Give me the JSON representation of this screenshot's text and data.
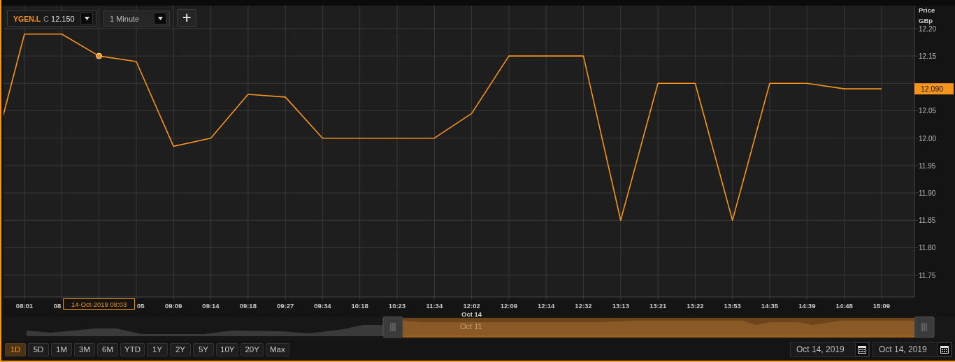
{
  "instrument": {
    "symbol": "YGEN.L",
    "price_label": "C",
    "price": "12.150"
  },
  "interval": {
    "value": "1 Minute"
  },
  "add_button": {
    "label": "+"
  },
  "chart": {
    "axis_title": "Price",
    "axis_unit": "GBp",
    "tooltip": "14-Oct-2019 08:03",
    "date_label": "Oct 14",
    "last_price": "12.090",
    "chart_data": {
      "type": "line",
      "grid": true,
      "categories": [
        null,
        "08:01",
        "08",
        null,
        "05",
        "09:09",
        "09:14",
        "09:18",
        "09:27",
        "09:34",
        "10:18",
        "10:23",
        "11:34",
        "12:02",
        "12:09",
        "12:14",
        "12:32",
        "13:13",
        "13:21",
        "13:22",
        "13:53",
        "14:35",
        "14:39",
        "14:48",
        "15:09"
      ],
      "series": [
        {
          "color": "#f7941d",
          "values": [
            11.93,
            12.19,
            12.19,
            12.15,
            12.14,
            11.985,
            12.0,
            12.08,
            12.075,
            12.0,
            12.0,
            12.0,
            12.0,
            12.045,
            12.15,
            12.15,
            12.15,
            11.85,
            12.1,
            12.1,
            11.85,
            12.1,
            12.1,
            12.09,
            12.09
          ]
        }
      ],
      "ylim": [
        11.71,
        12.242
      ],
      "yticks": [
        {
          "value": 12.2,
          "label": "12.20"
        },
        {
          "value": 12.15,
          "label": "12.15"
        },
        {
          "value": 12.05,
          "label": "12.05"
        },
        {
          "value": 12.0,
          "label": "12.00"
        },
        {
          "value": 11.95,
          "label": "11.95"
        },
        {
          "value": 11.9,
          "label": "11.90"
        },
        {
          "value": 11.85,
          "label": "11.85"
        },
        {
          "value": 11.8,
          "label": "11.80"
        },
        {
          "value": 11.75,
          "label": "11.75"
        }
      ]
    }
  },
  "navigator": {
    "selection_label": "Oct 11"
  },
  "ranges": [
    {
      "label": "1D",
      "selected": true
    },
    {
      "label": "5D",
      "selected": false
    },
    {
      "label": "1M",
      "selected": false
    },
    {
      "label": "3M",
      "selected": false
    },
    {
      "label": "6M",
      "selected": false
    },
    {
      "label": "YTD",
      "selected": false
    },
    {
      "label": "1Y",
      "selected": false
    },
    {
      "label": "2Y",
      "selected": false
    },
    {
      "label": "5Y",
      "selected": false
    },
    {
      "label": "10Y",
      "selected": false
    },
    {
      "label": "20Y",
      "selected": false
    },
    {
      "label": "Max",
      "selected": false
    }
  ],
  "date_fields": [
    {
      "value": "Oct 14, 2019"
    },
    {
      "value": "Oct 14, 2019"
    }
  ]
}
